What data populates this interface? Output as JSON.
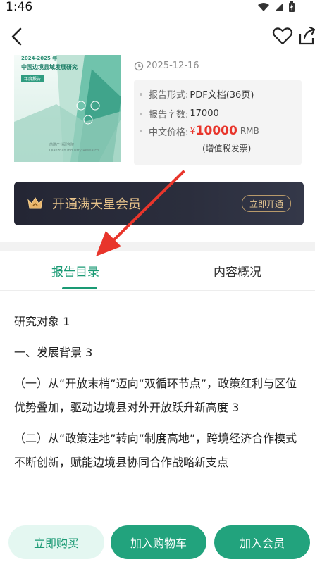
{
  "status_bar": {
    "time": "1:46"
  },
  "report": {
    "cover": {
      "year": "2024-2025 年",
      "title": "中国边境县域发展研究",
      "tag": "年度报告",
      "publisher_line1": "前瞻产业研究院",
      "publisher_line2": "Qianzhan Industry Research"
    },
    "date": "2025-12-16",
    "info": {
      "format_label": "报告形式:",
      "format_value": "PDF文档(36页)",
      "words_label": "报告字数:",
      "words_value": "17000",
      "price_label": "中文价格:",
      "price_symbol": "¥",
      "price_value": "10000",
      "price_unit": "RMB",
      "tax_note": "(增值税发票)"
    }
  },
  "vip": {
    "text": "开通满天星会员",
    "button": "立即开通"
  },
  "tabs": {
    "catalog": "报告目录",
    "overview": "内容概况"
  },
  "toc": [
    "研究对象 1",
    "一、发展背景 3",
    "（一）从“开放末梢”迈向“双循环节点”，政策红利与区位优势叠加，驱动边境县对外开放跃升新高度 3",
    "（二）从“政策洼地”转向“制度高地”，跨境经济合作模式不断创新，赋能边境县协同合作战略新支点"
  ],
  "bottom": {
    "buy": "立即购买",
    "cart": "加入购物车",
    "member": "加入会员"
  },
  "colors": {
    "accent": "#1a9a74",
    "price": "#e8352b",
    "vip_gold": "#e9c48b",
    "arrow": "#e8352b"
  }
}
